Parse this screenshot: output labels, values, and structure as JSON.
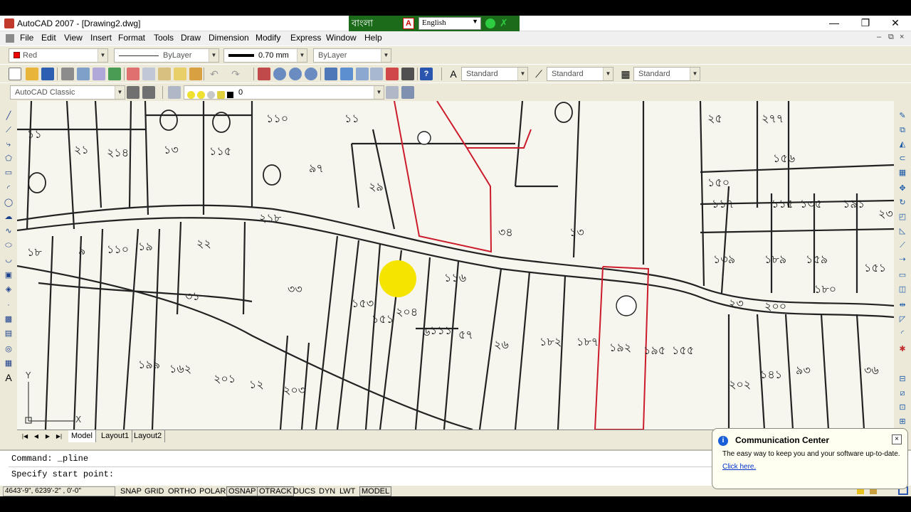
{
  "window": {
    "title": "AutoCAD 2007 - [Drawing2.dwg]",
    "minimize": "—",
    "restore": "❐",
    "close": "✕"
  },
  "langbar": {
    "brand": "বাংলা",
    "pdf": "A",
    "language": "English",
    "go": "",
    "exit": "✗"
  },
  "menu": [
    "File",
    "Edit",
    "View",
    "Insert",
    "Format",
    "Tools",
    "Draw",
    "Dimension",
    "Modify",
    "Express",
    "Window",
    "Help"
  ],
  "mdi_controls": {
    "min": "–",
    "restore": "⧉",
    "close": "×"
  },
  "properties": {
    "color": "Red",
    "linetype": "ByLayer",
    "lineweight": "0.70 mm",
    "plotstyle": "ByLayer"
  },
  "styles": {
    "text_style": "Standard",
    "dim_style": "Standard",
    "table_style": "Standard"
  },
  "workspace": "AutoCAD Classic",
  "layer": "0",
  "tabs": {
    "model": "Model",
    "layout1": "Layout1",
    "layout2": "Layout2"
  },
  "command": {
    "line1": "Command: _pline",
    "line2": "Specify start point:"
  },
  "status": {
    "coords": "4643'-9\",  6239'-2\" , 0'-0\"",
    "buttons": [
      "SNAP",
      "GRID",
      "ORTHO",
      "POLAR",
      "OSNAP",
      "OTRACK",
      "DUCS",
      "DYN",
      "LWT",
      "MODEL"
    ]
  },
  "ucs": {
    "y": "Y",
    "x": "X"
  },
  "comm_center": {
    "title": "Communication Center",
    "body": "The easy way to keep you and your software up-to-date.",
    "link": "Click here.",
    "close": "×"
  },
  "map_labels": [
    "১১০",
    "১১",
    "১১",
    "২১",
    "২১৪",
    "১৩",
    "১১৫",
    "৯৭",
    "২৯",
    "১৮",
    "৯",
    "১১০",
    "১৯",
    "২২",
    "২১৮",
    "৩১",
    "৩৩",
    "১৫৩",
    "১৫১",
    "২০৪",
    "৬",
    "১১৬",
    "৩৪",
    "১৩",
    "২৫",
    "২৭৭",
    "১৫৬",
    "১৫০",
    "১১৭",
    "১১৫",
    "১৩৫",
    "১৯১",
    "২৩",
    "১৩৯",
    "১৮৯",
    "১৫৯",
    "১৫১",
    "১৮০",
    "২৩",
    "২০০",
    "১১১",
    "৫৭",
    "২৬",
    "১৮২",
    "১৮৭",
    "১৯২",
    "১৯৫",
    "১৫৫",
    "১৯৯",
    "১৬২",
    "২০১",
    "১২",
    "২০৩",
    "২০২",
    "১৪১",
    "৯৩",
    "৩৬"
  ],
  "colors": {
    "accent_red": "#cc1b2b",
    "highlight": "#f5e400"
  }
}
